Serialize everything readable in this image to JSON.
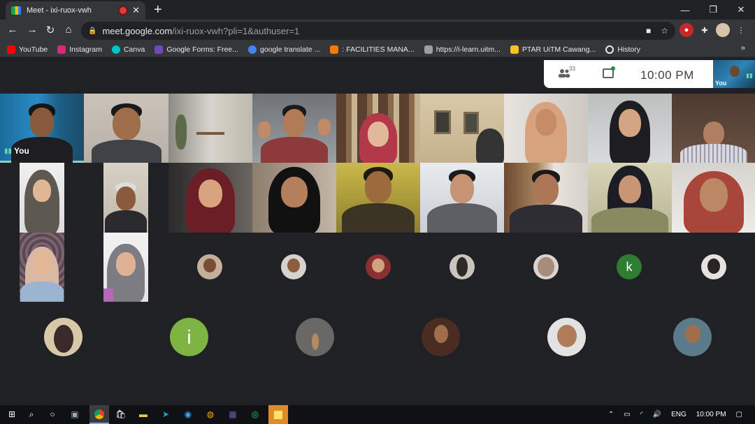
{
  "browser": {
    "tab_title": "Meet - ixi-ruox-vwh",
    "tab_close": "✕",
    "new_tab": "+",
    "window_controls": [
      "—",
      "❐",
      "✕"
    ],
    "url_host": "meet.google.com",
    "url_path": "/ixi-ruox-vwh?pli=1&authuser=1"
  },
  "bookmarks": [
    {
      "label": "YouTube",
      "color": "#ff0000"
    },
    {
      "label": "Instagram",
      "color": "#d62976"
    },
    {
      "label": "Canva",
      "color": "#00c4cc"
    },
    {
      "label": "Google Forms: Free...",
      "color": "#7248b9"
    },
    {
      "label": "google translate ...",
      "color": "#4285f4"
    },
    {
      "label": ": FACILITIES MANA...",
      "color": "#f57c00"
    },
    {
      "label": "https://i-learn.uitm...",
      "color": "#9e9e9e"
    },
    {
      "label": "PTAR UiTM Cawang...",
      "color": "#fbc02d"
    },
    {
      "label": "History",
      "color": "#5f6368"
    }
  ],
  "bookmarks_more": "»",
  "meet": {
    "participant_count": "33",
    "time": "10:00 PM",
    "self_label": "You",
    "self_tile_label": "You",
    "avatar_letters": {
      "k": "k",
      "i": "i"
    },
    "colors": {
      "k_avatar": "#2e7d32",
      "i_avatar": "#7cb342",
      "speaking": "#62d2b2"
    }
  },
  "taskbar": {
    "lang": "ENG",
    "time": "10:00 PM"
  }
}
